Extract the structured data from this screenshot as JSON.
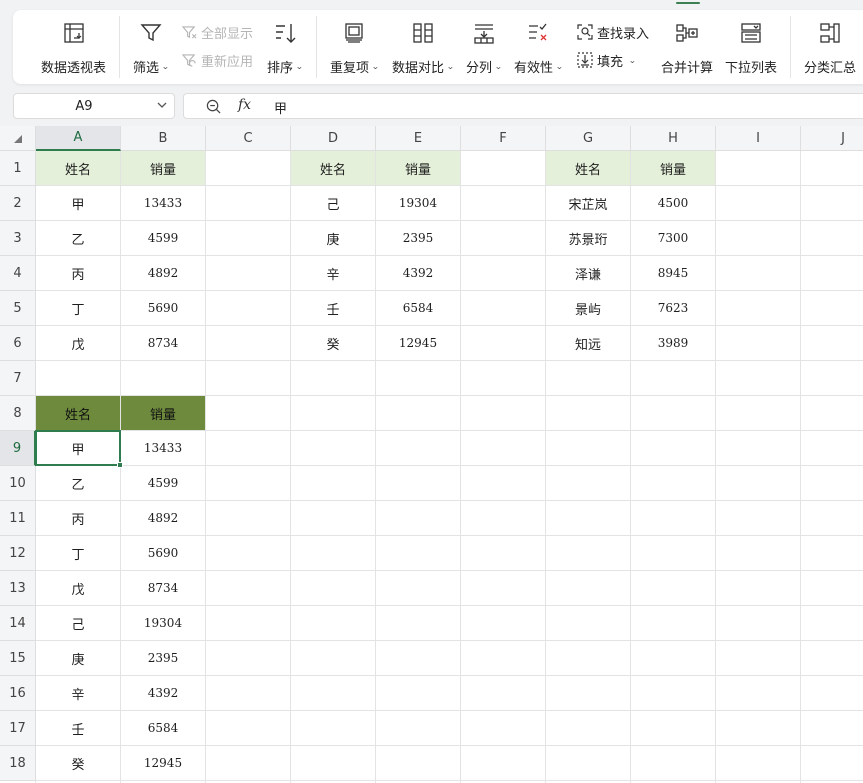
{
  "ribbon": {
    "pivot_table": "数据透视表",
    "filter": "筛选",
    "show_all": "全部显示",
    "reapply": "重新应用",
    "sort": "排序",
    "duplicates": "重复项",
    "data_compare": "数据对比",
    "split_column": "分列",
    "validity": "有效性",
    "find_entry": "查找录入",
    "fill": "填充",
    "consolidate": "合并计算",
    "dropdown_list": "下拉列表",
    "subtotal": "分类汇总"
  },
  "formula_bar": {
    "name_box": "A9",
    "fx_label": "fx",
    "value": "甲"
  },
  "sheet": {
    "columns": [
      "A",
      "B",
      "C",
      "D",
      "E",
      "F",
      "G",
      "H",
      "I",
      "J"
    ],
    "rows": [
      "1",
      "2",
      "3",
      "4",
      "5",
      "6",
      "7",
      "8",
      "9",
      "10",
      "11",
      "12",
      "13",
      "14",
      "15",
      "16",
      "17",
      "18"
    ],
    "selected_cell": "A9",
    "colors": {
      "light_header_fill": "#e4f0da",
      "dark_header_fill": "#6e8b3d",
      "selection": "#2f7d4f"
    },
    "cells": [
      {
        "ref": "A1",
        "v": "姓名",
        "style": "lhdr"
      },
      {
        "ref": "B1",
        "v": "销量",
        "style": "lhdr"
      },
      {
        "ref": "A2",
        "v": "甲"
      },
      {
        "ref": "B2",
        "v": "13433"
      },
      {
        "ref": "A3",
        "v": "乙"
      },
      {
        "ref": "B3",
        "v": "4599"
      },
      {
        "ref": "A4",
        "v": "丙"
      },
      {
        "ref": "B4",
        "v": "4892"
      },
      {
        "ref": "A5",
        "v": "丁"
      },
      {
        "ref": "B5",
        "v": "5690"
      },
      {
        "ref": "A6",
        "v": "戊"
      },
      {
        "ref": "B6",
        "v": "8734"
      },
      {
        "ref": "D1",
        "v": "姓名",
        "style": "lhdr"
      },
      {
        "ref": "E1",
        "v": "销量",
        "style": "lhdr"
      },
      {
        "ref": "D2",
        "v": "己"
      },
      {
        "ref": "E2",
        "v": "19304"
      },
      {
        "ref": "D3",
        "v": "庚"
      },
      {
        "ref": "E3",
        "v": "2395"
      },
      {
        "ref": "D4",
        "v": "辛"
      },
      {
        "ref": "E4",
        "v": "4392"
      },
      {
        "ref": "D5",
        "v": "壬"
      },
      {
        "ref": "E5",
        "v": "6584"
      },
      {
        "ref": "D6",
        "v": "癸"
      },
      {
        "ref": "E6",
        "v": "12945"
      },
      {
        "ref": "G1",
        "v": "姓名",
        "style": "lhdr"
      },
      {
        "ref": "H1",
        "v": "销量",
        "style": "lhdr"
      },
      {
        "ref": "G2",
        "v": "宋芷岚"
      },
      {
        "ref": "H2",
        "v": "4500"
      },
      {
        "ref": "G3",
        "v": "苏景珩"
      },
      {
        "ref": "H3",
        "v": "7300"
      },
      {
        "ref": "G4",
        "v": "泽谦"
      },
      {
        "ref": "H4",
        "v": "8945"
      },
      {
        "ref": "G5",
        "v": "景屿"
      },
      {
        "ref": "H5",
        "v": "7623"
      },
      {
        "ref": "G6",
        "v": "知远"
      },
      {
        "ref": "H6",
        "v": "3989"
      },
      {
        "ref": "A8",
        "v": "姓名",
        "style": "dhdr"
      },
      {
        "ref": "B8",
        "v": "销量",
        "style": "dhdr"
      },
      {
        "ref": "A9",
        "v": "甲"
      },
      {
        "ref": "B9",
        "v": "13433"
      },
      {
        "ref": "A10",
        "v": "乙"
      },
      {
        "ref": "B10",
        "v": "4599"
      },
      {
        "ref": "A11",
        "v": "丙"
      },
      {
        "ref": "B11",
        "v": "4892"
      },
      {
        "ref": "A12",
        "v": "丁"
      },
      {
        "ref": "B12",
        "v": "5690"
      },
      {
        "ref": "A13",
        "v": "戊"
      },
      {
        "ref": "B13",
        "v": "8734"
      },
      {
        "ref": "A14",
        "v": "己"
      },
      {
        "ref": "B14",
        "v": "19304"
      },
      {
        "ref": "A15",
        "v": "庚"
      },
      {
        "ref": "B15",
        "v": "2395"
      },
      {
        "ref": "A16",
        "v": "辛"
      },
      {
        "ref": "B16",
        "v": "4392"
      },
      {
        "ref": "A17",
        "v": "壬"
      },
      {
        "ref": "B17",
        "v": "6584"
      },
      {
        "ref": "A18",
        "v": "癸"
      },
      {
        "ref": "B18",
        "v": "12945"
      }
    ]
  }
}
